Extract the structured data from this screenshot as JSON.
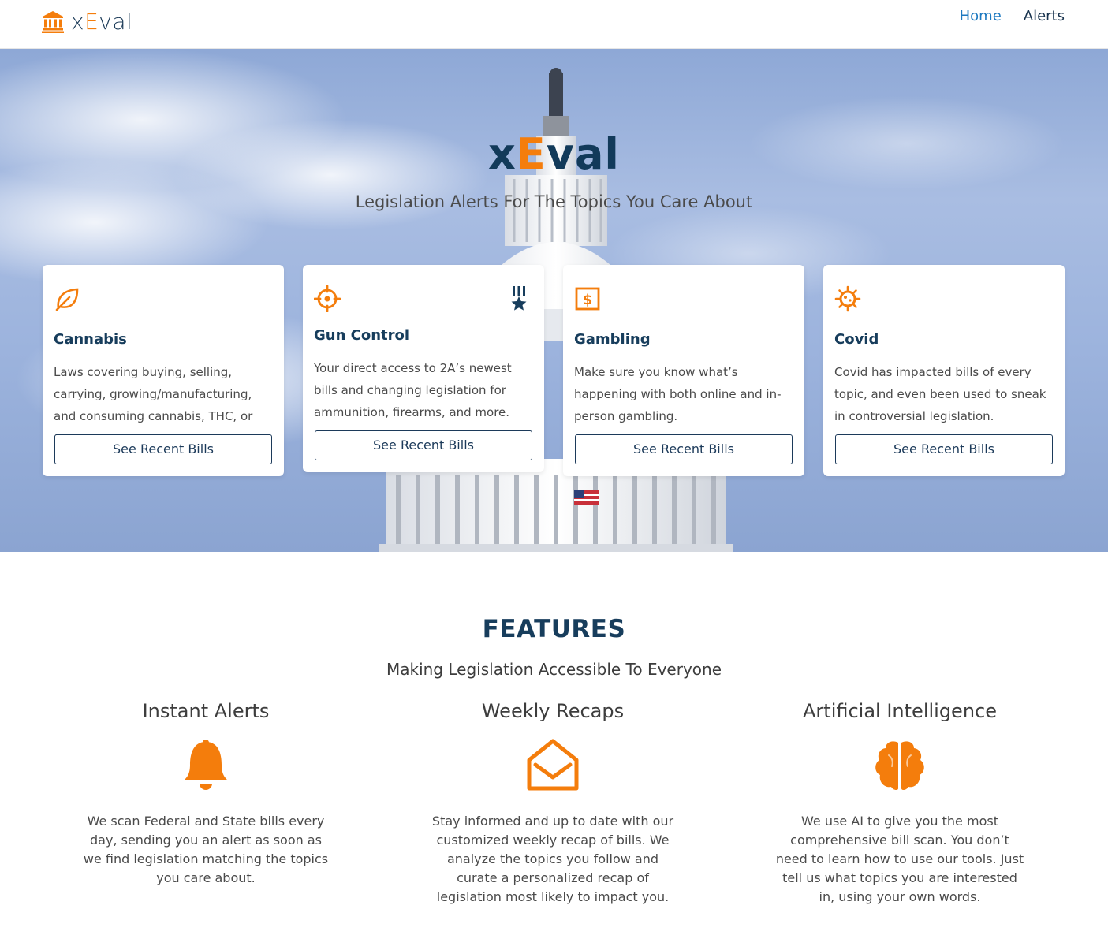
{
  "colors": {
    "navy": "#173d5c",
    "orange": "#f47d0c",
    "link_blue": "#1d79c0"
  },
  "nav": {
    "brand_prefix": "x",
    "brand_e": "E",
    "brand_suffix": "val",
    "links": [
      {
        "label": "Home",
        "active": true
      },
      {
        "label": "Alerts",
        "active": false
      }
    ]
  },
  "hero": {
    "title_prefix": "x",
    "title_e": "E",
    "title_suffix": "val",
    "subtitle": "Legislation Alerts For The Topics You Care About"
  },
  "cards": [
    {
      "icon": "leaf-icon",
      "title": "Cannabis",
      "description": "Laws covering buying, selling, carrying, growing/manufacturing, and consuming cannabis, THC, or CBD.",
      "button": "See Recent Bills"
    },
    {
      "icon": "crosshair-icon",
      "badge": "medal-star-icon",
      "title": "Gun Control",
      "description": "Your direct access to 2A’s newest bills and changing legislation for ammunition, firearms, and more.",
      "button": "See Recent Bills"
    },
    {
      "icon": "dollar-icon",
      "title": "Gambling",
      "description": "Make sure you know what’s happening with both online and in-person gambling.",
      "button": "See Recent Bills"
    },
    {
      "icon": "virus-icon",
      "title": "Covid",
      "description": "Covid has impacted bills of every topic, and even been used to sneak in controversial legislation.",
      "button": "See Recent Bills"
    }
  ],
  "features": {
    "title": "FEATURES",
    "subtitle": "Making Legislation Accessible To Everyone",
    "items": [
      {
        "icon": "bell-icon",
        "title": "Instant Alerts",
        "description": "We scan Federal and State bills every day, sending you an alert as soon as we find legislation matching the topics you care about."
      },
      {
        "icon": "envelope-open-icon",
        "title": "Weekly Recaps",
        "description": "Stay informed and up to date with our customized weekly recap of bills. We analyze the topics you follow and curate a personalized recap of legislation most likely to impact you."
      },
      {
        "icon": "brain-icon",
        "title": "Artificial Intelligence",
        "description": "We use AI to give you the most comprehensive bill scan. You don’t need to learn how to use our tools. Just tell us what topics you are interested in, using your own words."
      }
    ]
  }
}
